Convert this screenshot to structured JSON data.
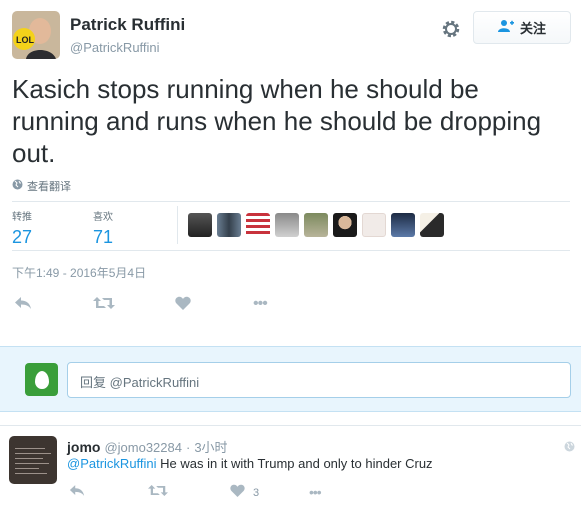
{
  "tweet": {
    "author_name": "Patrick Ruffini",
    "author_handle": "@PatrickRuffini",
    "follow_label": "关注",
    "text": "Kasich stops running when he should be running and runs when he should be dropping out.",
    "translate_label": "查看翻译",
    "stats": {
      "retweets_label": "转推",
      "retweets_value": "27",
      "likes_label": "喜欢",
      "likes_value": "71"
    },
    "timestamp": "下午1:49 - 2016年5月4日",
    "more_label": "•••"
  },
  "reply_box": {
    "placeholder": "回复 ",
    "mention": "@PatrickRuffini"
  },
  "reply": {
    "name": "jomo",
    "handle": "@jomo32284",
    "separator": "·",
    "time": "3小时",
    "mention": "@PatrickRuffini",
    "text": " He was in it with Trump and only to hinder Cruz",
    "like_count": "3",
    "more_label": "•••"
  },
  "colors": {
    "link": "#1b95e0",
    "icon_gray": "#aab8c2",
    "reply_bg": "#e8f5fd"
  }
}
